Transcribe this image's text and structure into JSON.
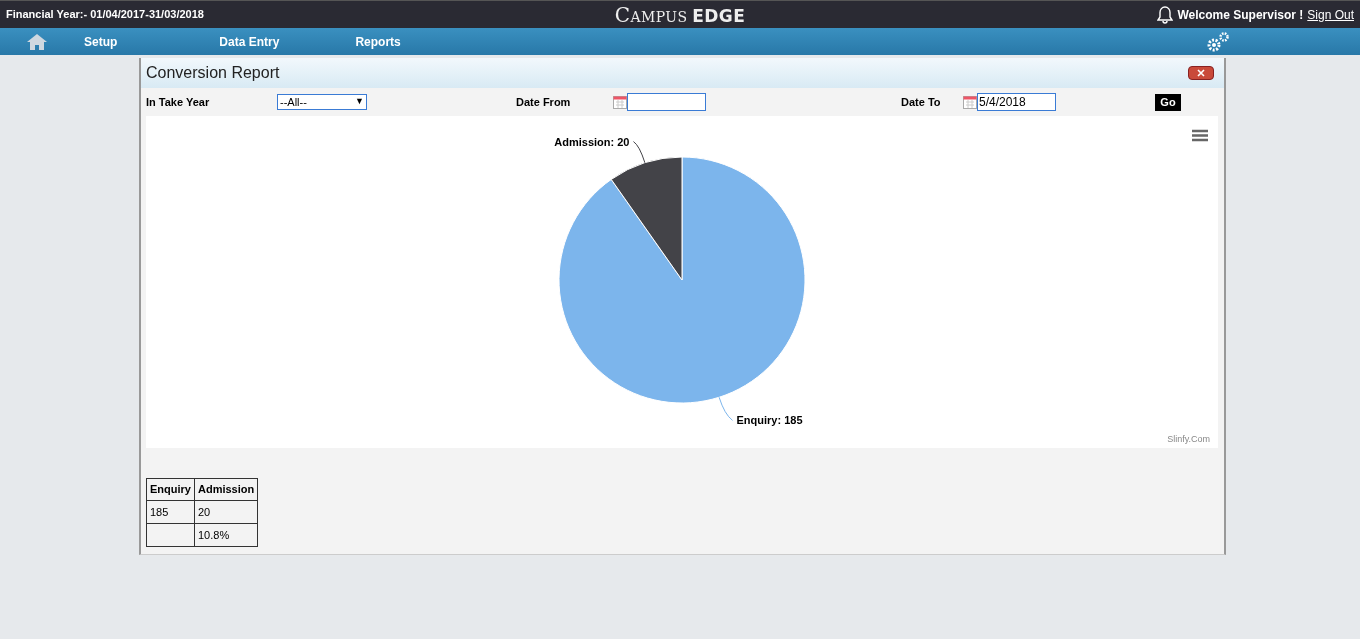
{
  "header": {
    "financial_year": "Financial Year:- 01/04/2017-31/03/2018",
    "logo_small": "C",
    "logo_rest": "AMPUS",
    "logo_bold": "EDGE",
    "welcome": "Welcome Supervisor !",
    "sign_out": "Sign Out"
  },
  "nav": {
    "items": [
      "Setup",
      "Data Entry",
      "Reports"
    ]
  },
  "report": {
    "title": "Conversion Report",
    "filters": {
      "intake_label": "In Take Year",
      "intake_value": "--All--",
      "intake_arrow": "▼",
      "date_from_label": "Date From",
      "date_to_label": "Date To",
      "date_to_value": "5/4/2018",
      "go": "Go"
    },
    "chart": {
      "credits": "Slinfy.Com",
      "chart_data": {
        "type": "pie",
        "categories": [
          "Enquiry: 185",
          "Admission: 20"
        ],
        "values": [
          185,
          20
        ],
        "colors": [
          "#7cb5ec",
          "#434348"
        ]
      }
    },
    "table": {
      "columns": [
        "Enquiry",
        "Admission"
      ],
      "rows": [
        [
          "185",
          "20"
        ],
        [
          "",
          "10.8%"
        ]
      ]
    }
  }
}
